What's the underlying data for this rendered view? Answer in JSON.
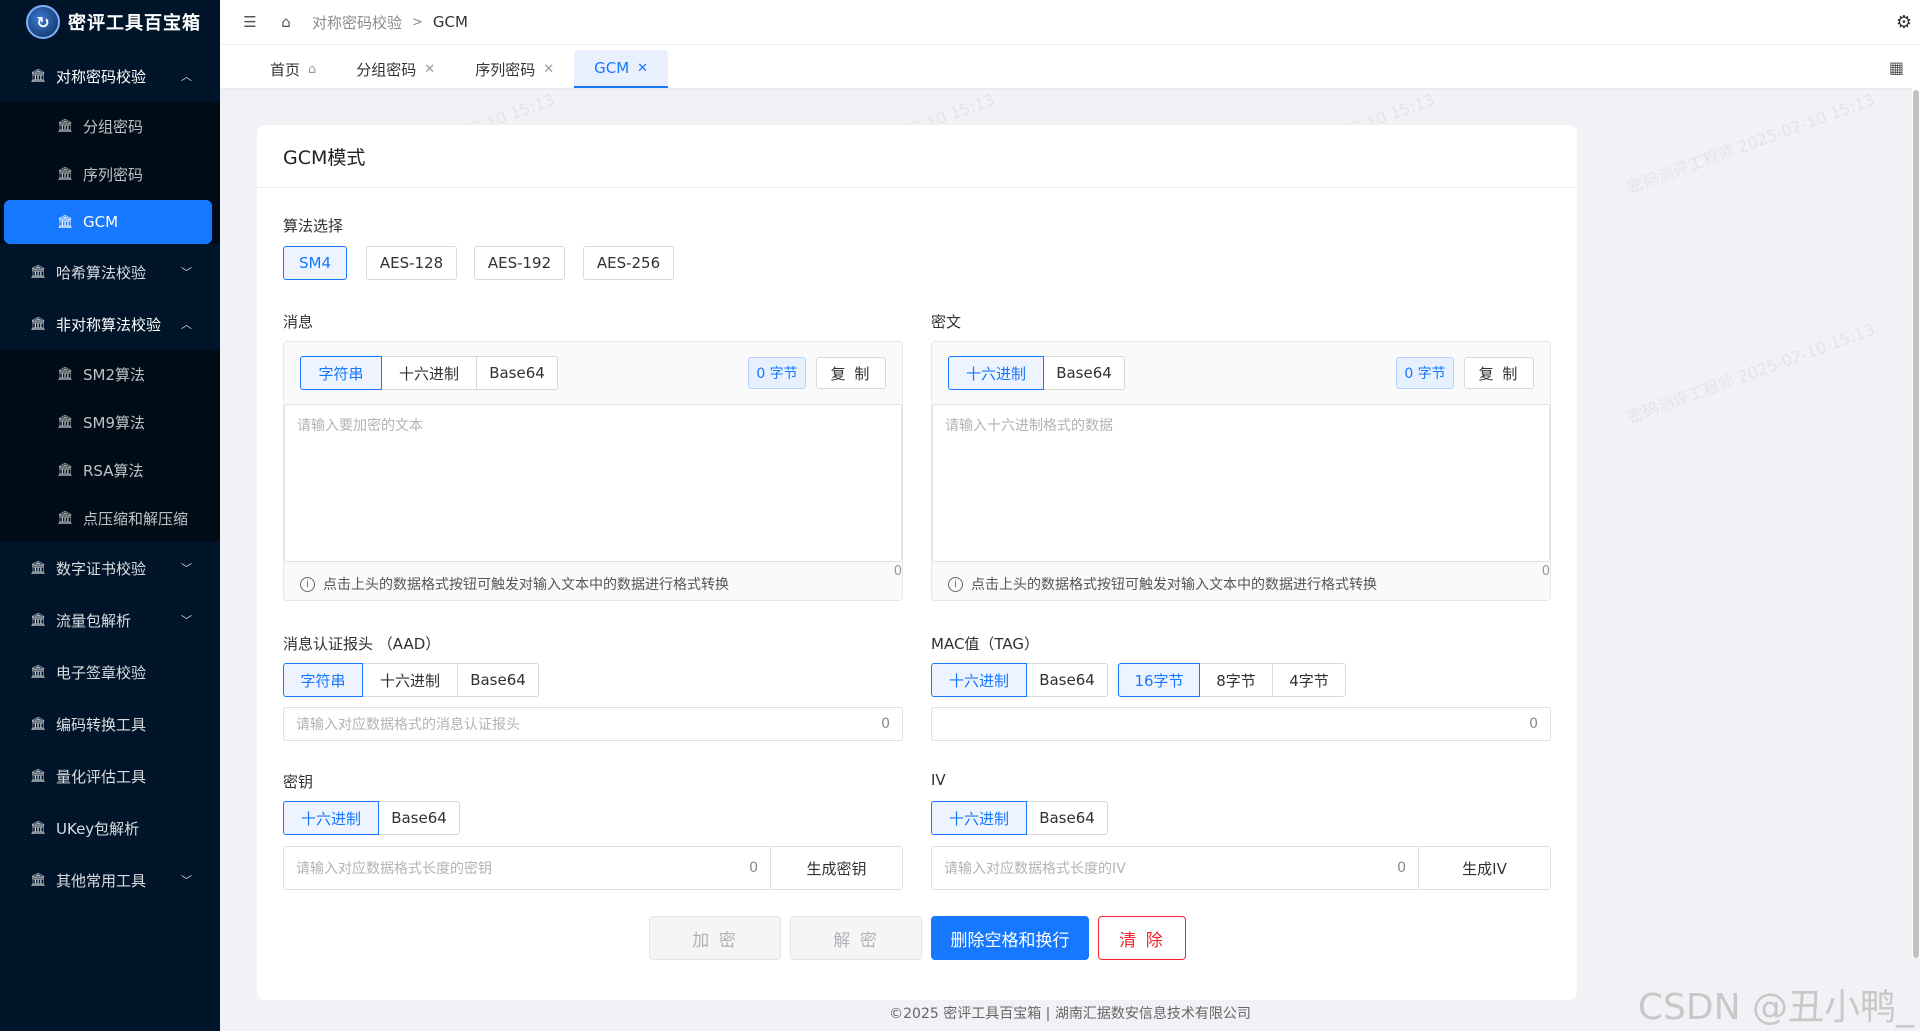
{
  "app": {
    "logo_mark": "↻",
    "title": "密评工具百宝箱"
  },
  "sidebar": {
    "groups": [
      {
        "label": "对称密码校验",
        "open": true,
        "items": [
          "分组密码",
          "序列密码",
          "GCM"
        ]
      },
      {
        "label": "哈希算法校验"
      },
      {
        "label": "非对称算法校验",
        "open": true,
        "items": [
          "SM2算法",
          "SM9算法",
          "RSA算法",
          "点压缩和解压缩"
        ]
      },
      {
        "label": "数字证书校验"
      },
      {
        "label": "流量包解析"
      },
      {
        "label": "电子签章校验"
      },
      {
        "label": "编码转换工具"
      },
      {
        "label": "量化评估工具"
      },
      {
        "label": "UKey包解析"
      },
      {
        "label": "其他常用工具"
      }
    ]
  },
  "breadcrumb": {
    "parent": "对称密码校验",
    "sep": ">",
    "current": "GCM"
  },
  "tabs": [
    {
      "label": "首页",
      "icon": "home-icon"
    },
    {
      "label": "分组密码"
    },
    {
      "label": "序列密码"
    },
    {
      "label": "GCM",
      "active": true
    }
  ],
  "page": {
    "title": "GCM模式",
    "algo_label": "算法选择",
    "algos": [
      "SM4",
      "AES-128",
      "AES-192",
      "AES-256"
    ],
    "message": {
      "label": "消息",
      "formats": [
        "字符串",
        "十六进制",
        "Base64"
      ],
      "bytes": "0 字节",
      "copy": "复 制",
      "placeholder": "请输入要加密的文本",
      "hint": "点击上头的数据格式按钮可触发对输入文本中的数据进行格式转换",
      "count": "0"
    },
    "cipher": {
      "label": "密文",
      "formats": [
        "十六进制",
        "Base64"
      ],
      "bytes": "0 字节",
      "copy": "复 制",
      "placeholder": "请输入十六进制格式的数据",
      "hint": "点击上头的数据格式按钮可触发对输入文本中的数据进行格式转换",
      "count": "0"
    },
    "aad": {
      "label": "消息认证报头 （AAD）",
      "formats": [
        "字符串",
        "十六进制",
        "Base64"
      ],
      "placeholder": "请输入对应数据格式的消息认证报头",
      "count": "0"
    },
    "tag": {
      "label": "MAC值（TAG）",
      "formats": [
        "十六进制",
        "Base64"
      ],
      "lengths": [
        "16字节",
        "8字节",
        "4字节"
      ],
      "count": "0"
    },
    "key": {
      "label": "密钥",
      "formats": [
        "十六进制",
        "Base64"
      ],
      "placeholder": "请输入对应数据格式长度的密钥",
      "count": "0",
      "button": "生成密钥"
    },
    "iv": {
      "label": "IV",
      "formats": [
        "十六进制",
        "Base64"
      ],
      "placeholder": "请输入对应数据格式长度的IV",
      "count": "0",
      "button": "生成IV"
    },
    "actions": {
      "encrypt": "加 密",
      "decrypt": "解 密",
      "strip": "删除空格和换行",
      "clear": "清 除"
    }
  },
  "footer": "©2025 密评工具百宝箱 | 湖南汇据数安信息技术有限公司",
  "watermark_corner": "CSDN @丑小鸭_",
  "watermark_text": "密码测评工程师 2025-02-10 15:13",
  "colors": {
    "sidebar_bg": "#001529",
    "primary": "#1677ff",
    "danger": "#f5222d"
  }
}
